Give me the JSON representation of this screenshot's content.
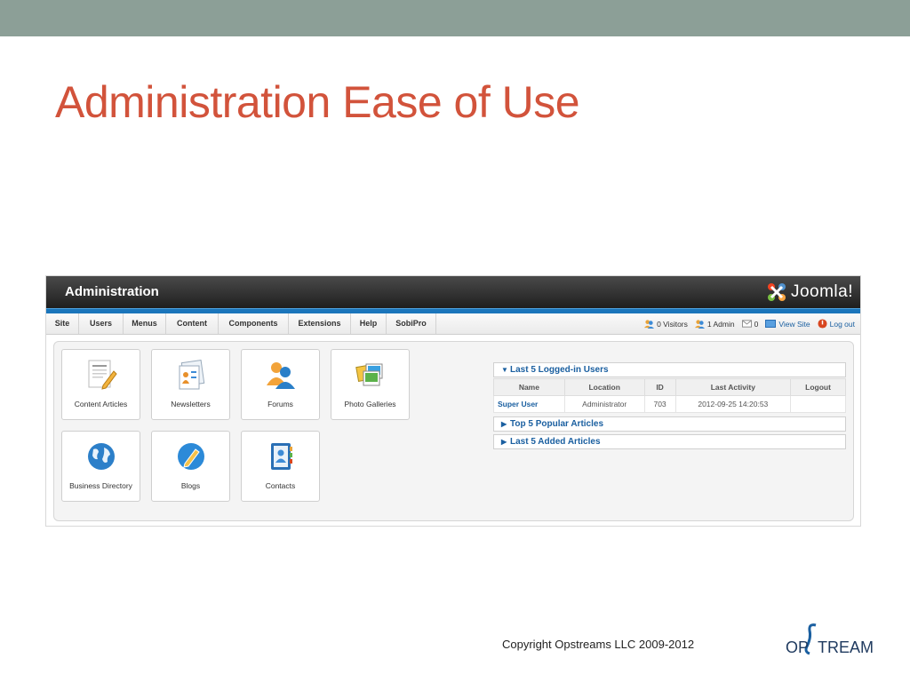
{
  "slide": {
    "title": "Administration Ease of Use",
    "copyright": "Copyright Opstreams LLC 2009-2012",
    "logo_text": "OPSTREAMS"
  },
  "admin": {
    "header_title": "Administration",
    "brand": "Joomla!",
    "menu": [
      "Site",
      "Users",
      "Menus",
      "Content",
      "Components",
      "Extensions",
      "Help",
      "SobiPro"
    ],
    "status": {
      "visitors": "0 Visitors",
      "admins": "1 Admin",
      "messages": "0",
      "view_site": "View Site",
      "logout": "Log out"
    },
    "quick_icons": [
      {
        "label": "Content Articles",
        "icon": "articles-icon"
      },
      {
        "label": "Newsletters",
        "icon": "newsletters-icon"
      },
      {
        "label": "Forums",
        "icon": "forums-icon"
      },
      {
        "label": "Photo Galleries",
        "icon": "photo-galleries-icon"
      },
      {
        "label": "Business Directory",
        "icon": "globe-icon"
      },
      {
        "label": "Blogs",
        "icon": "pencil-icon"
      },
      {
        "label": "Contacts",
        "icon": "contacts-book-icon"
      }
    ],
    "modules": {
      "logged_in": {
        "title": "Last 5 Logged-in Users",
        "columns": [
          "Name",
          "Location",
          "ID",
          "Last Activity",
          "Logout"
        ],
        "rows": [
          {
            "name": "Super User",
            "location": "Administrator",
            "id": "703",
            "last_activity": "2012-09-25 14:20:53",
            "logout": ""
          }
        ]
      },
      "popular": {
        "title": "Top 5 Popular Articles"
      },
      "added": {
        "title": "Last 5 Added Articles"
      }
    },
    "colors": {
      "slide_title": "#d2533b",
      "top_band": "#8c9f97",
      "link_blue": "#1a5fa0",
      "header_blue_strip": "#1a75bb"
    }
  }
}
